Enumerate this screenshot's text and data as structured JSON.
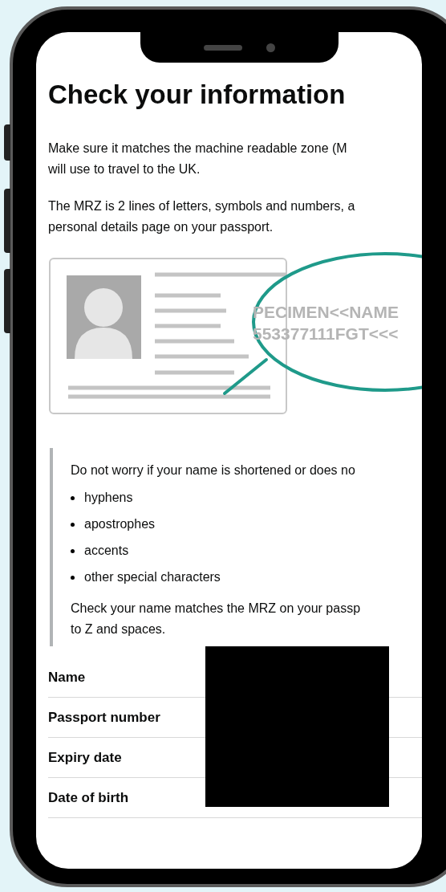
{
  "heading": "Check your information",
  "paragraphs": [
    {
      "lines": [
        "Make sure it matches the machine readable zone (M",
        "will use to travel to the UK."
      ]
    },
    {
      "lines": [
        "The MRZ is 2 lines of letters, symbols and numbers, a",
        "personal details page on your passport."
      ]
    }
  ],
  "illustration": {
    "mrz_lines": [
      "PECIMEN<<NAME",
      "553377111FGT<<<"
    ]
  },
  "inset": {
    "intro": "Do not worry if your name is shortened or does no",
    "bullets": [
      "hyphens",
      "apostrophes",
      "accents",
      "other special characters"
    ],
    "outro_lines": [
      "Check your name matches the MRZ on your passp",
      "to Z and spaces."
    ]
  },
  "summary": {
    "rows": [
      {
        "label": "Name"
      },
      {
        "label": "Passport number"
      },
      {
        "label": "Expiry date"
      },
      {
        "label": "Date of birth"
      }
    ],
    "redacted": true
  }
}
